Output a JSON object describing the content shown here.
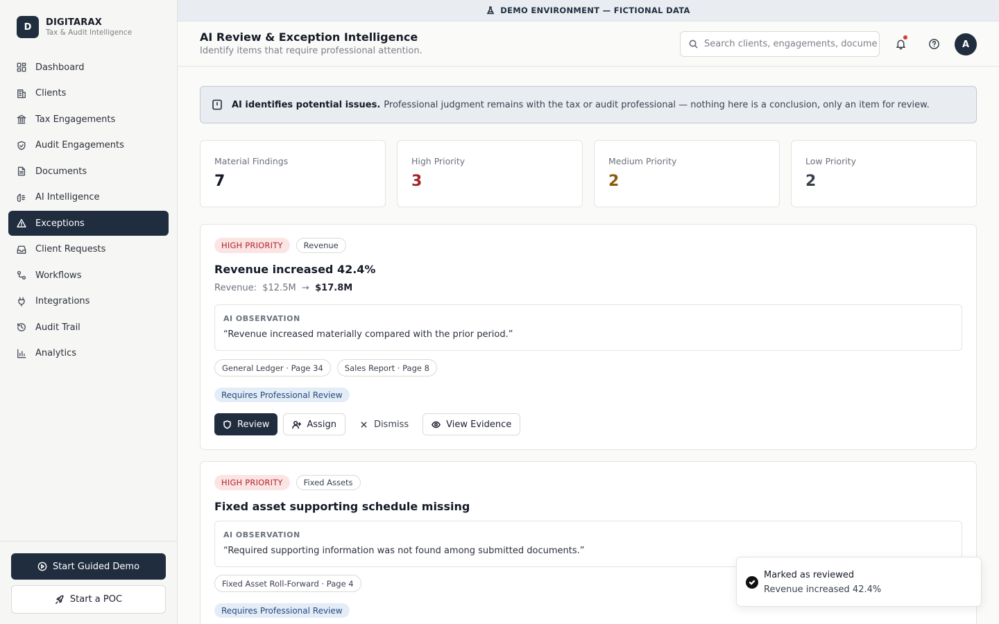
{
  "brand": {
    "logo_letter": "D",
    "name": "DIGITARAX",
    "tagline": "Tax & Audit Intelligence"
  },
  "sidebar": {
    "items": [
      {
        "label": "Dashboard",
        "icon": "dashboard-icon"
      },
      {
        "label": "Clients",
        "icon": "building-icon"
      },
      {
        "label": "Tax Engagements",
        "icon": "bank-icon"
      },
      {
        "label": "Audit Engagements",
        "icon": "shield-check-icon"
      },
      {
        "label": "Documents",
        "icon": "document-icon"
      },
      {
        "label": "AI Intelligence",
        "icon": "brain-icon"
      },
      {
        "label": "Exceptions",
        "icon": "warning-icon",
        "active": true
      },
      {
        "label": "Client Requests",
        "icon": "inbox-icon"
      },
      {
        "label": "Workflows",
        "icon": "workflow-icon"
      },
      {
        "label": "Integrations",
        "icon": "plug-icon"
      },
      {
        "label": "Audit Trail",
        "icon": "history-icon"
      },
      {
        "label": "Analytics",
        "icon": "bar-chart-icon"
      }
    ],
    "guided_demo_label": "Start Guided Demo",
    "poc_label": "Start a POC"
  },
  "banner": {
    "text": "DEMO ENVIRONMENT — FICTIONAL DATA"
  },
  "header": {
    "title": "AI Review & Exception Intelligence",
    "subtitle": "Identify items that require professional attention.",
    "search_placeholder": "Search clients, engagements, documents...",
    "avatar_letter": "A"
  },
  "notice": {
    "bold": "AI identifies potential issues.",
    "text": "Professional judgment remains with the tax or audit professional — nothing here is a conclusion, only an item for review."
  },
  "stats": [
    {
      "label": "Material Findings",
      "value": "7",
      "color": "#141a26"
    },
    {
      "label": "High Priority",
      "value": "3",
      "color": "#a3262a"
    },
    {
      "label": "Medium Priority",
      "value": "2",
      "color": "#8a5a0b"
    },
    {
      "label": "Low Priority",
      "value": "2",
      "color": "#3a414d"
    }
  ],
  "findings": [
    {
      "priority": "HIGH PRIORITY",
      "category": "Revenue",
      "title": "Revenue increased 42.4%",
      "metric_label": "Revenue:",
      "metric_from": "$12.5M",
      "metric_arrow": "→",
      "metric_to": "$17.8M",
      "observation_label": "AI OBSERVATION",
      "observation": "“Revenue increased materially compared with the prior period.”",
      "references": [
        "General Ledger · Page 34",
        "Sales Report · Page 8"
      ],
      "status": "Requires Professional Review",
      "actions": {
        "review": "Review",
        "assign": "Assign",
        "dismiss": "Dismiss",
        "evidence": "View Evidence"
      }
    },
    {
      "priority": "HIGH PRIORITY",
      "category": "Fixed Assets",
      "title": "Fixed asset supporting schedule missing",
      "observation_label": "AI OBSERVATION",
      "observation": "“Required supporting information was not found among submitted documents.”",
      "references": [
        "Fixed Asset Roll-Forward · Page 4"
      ],
      "status": "Requires Professional Review"
    }
  ],
  "toast": {
    "title": "Marked as reviewed",
    "message": "Revenue increased 42.4%"
  }
}
